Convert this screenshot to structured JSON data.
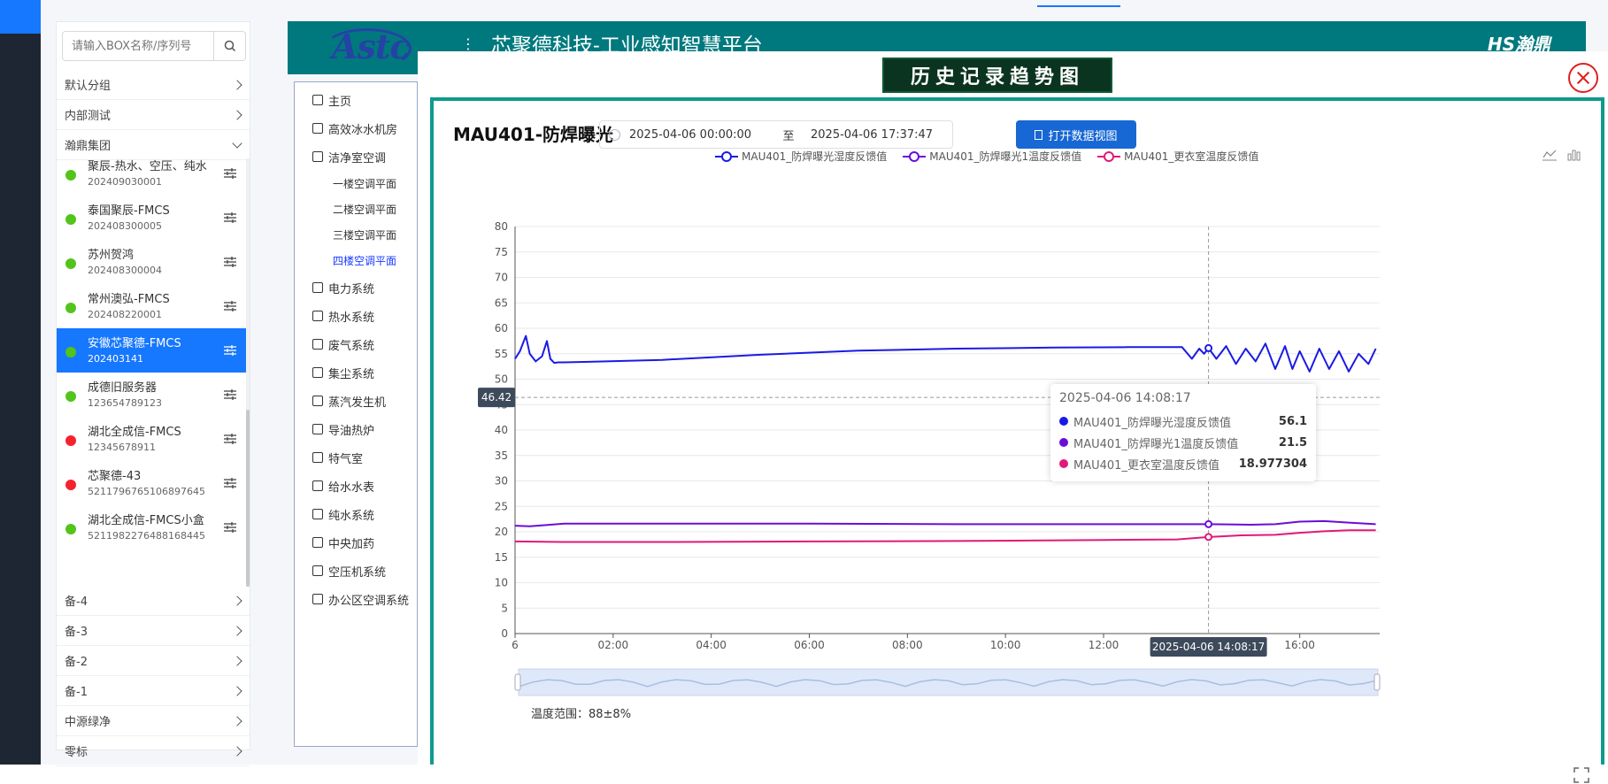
{
  "colors": {
    "accent": "#1677ff",
    "header": "#00797e",
    "frame": "#0f9a8e",
    "online": "#52c41a",
    "offline": "#f5222d"
  },
  "sidebar": {
    "search_placeholder": "请输入BOX名称/序列号",
    "groups_top": [
      "默认分组",
      "内部测试",
      "瀚鼎集团"
    ],
    "devices": [
      {
        "name": "聚辰-热水、空压、纯水",
        "sn": "202409030001",
        "status": "online",
        "active": false
      },
      {
        "name": "泰国聚辰-FMCS",
        "sn": "202408300005",
        "status": "online",
        "active": false
      },
      {
        "name": "苏州贺鸿",
        "sn": "202408300004",
        "status": "online",
        "active": false
      },
      {
        "name": "常州澳弘-FMCS",
        "sn": "202408220001",
        "status": "online",
        "active": false
      },
      {
        "name": "安徽芯聚德-FMCS",
        "sn": "202403141",
        "status": "online",
        "active": true
      },
      {
        "name": "成德旧服务器",
        "sn": "123654789123",
        "status": "online",
        "active": false
      },
      {
        "name": "湖北全成信-FMCS",
        "sn": "12345678911",
        "status": "offline",
        "active": false
      },
      {
        "name": "芯聚德-43",
        "sn": "5211796765106897645",
        "status": "offline",
        "active": false
      },
      {
        "name": "湖北全成信-FMCS小盒",
        "sn": "5211982276488168445",
        "status": "online",
        "active": false
      }
    ],
    "groups_bottom": [
      "备-4",
      "备-3",
      "备-2",
      "备-1",
      "中源绿净",
      "零标"
    ]
  },
  "header": {
    "logo": "Astc",
    "title": "芯聚德科技-工业感知智慧平台",
    "brand": "HS瀚鼎"
  },
  "nav": {
    "items": [
      "主页",
      "高效冰水机房",
      "洁净室空调"
    ],
    "subs": [
      "一楼空调平面",
      "二楼空调平面",
      "三楼空调平面",
      "四楼空调平面"
    ],
    "items2": [
      "电力系统",
      "热水系统",
      "废气系统",
      "集尘系统",
      "蒸汽发生机",
      "导油热炉",
      "特气室",
      "给水水表",
      "纯水系统",
      "中央加药",
      "空压机系统",
      "办公区空调系统"
    ]
  },
  "modal": {
    "title": "历史记录趋势图",
    "chart_name": "MAU401-防焊曝光",
    "date_start": "2025-04-06 00:00:00",
    "date_sep": "至",
    "date_end": "2025-04-06 17:37:47",
    "open_view": "打开数据视图",
    "temp_note": "温度范围：88±8%",
    "cursor_y_label": "46.42",
    "cursor_x_label": "2025-04-06 14:08:17"
  },
  "tooltip": {
    "time": "2025-04-06 14:08:17",
    "rows": [
      {
        "name": "MAU401_防焊曝光湿度反馈值",
        "value": "56.1",
        "color": "#1a1ae6"
      },
      {
        "name": "MAU401_防焊曝光1温度反馈值",
        "value": "21.5",
        "color": "#6a0dd9"
      },
      {
        "name": "MAU401_更衣室温度反馈值",
        "value": "18.977304",
        "color": "#e0197a"
      }
    ]
  },
  "chart_data": {
    "type": "line",
    "x_unit": "hour",
    "xlim": [
      0,
      17.63
    ],
    "x_ticks": [
      "6",
      "02:00",
      "04:00",
      "06:00",
      "08:00",
      "10:00",
      "12:00",
      "16:00"
    ],
    "x_tick_hours": [
      0,
      2,
      4,
      6,
      8,
      10,
      12,
      16
    ],
    "ylim": [
      0,
      80
    ],
    "y_ticks": [
      0,
      5,
      10,
      15,
      20,
      25,
      30,
      35,
      40,
      45,
      50,
      55,
      60,
      65,
      70,
      75,
      80
    ],
    "grid": true,
    "legend": "top",
    "series": [
      {
        "name": "MAU401_防焊曝光湿度反馈值",
        "color": "#1a1ae6",
        "x": [
          0,
          0.1,
          0.22,
          0.3,
          0.42,
          0.55,
          0.65,
          0.72,
          0.8,
          0.88,
          1.0,
          1.5,
          3,
          5,
          7,
          9,
          11,
          12.5,
          13.6,
          13.8,
          13.95,
          14.05,
          14.14,
          14.3,
          14.5,
          14.7,
          14.9,
          15.1,
          15.3,
          15.5,
          15.7,
          15.85,
          16.0,
          16.2,
          16.4,
          16.6,
          16.8,
          17.0,
          17.2,
          17.4,
          17.55
        ],
        "y": [
          54,
          55.5,
          58.5,
          55,
          53.5,
          54.5,
          57.5,
          54,
          53.2,
          53.3,
          53.3,
          53.4,
          53.8,
          54.8,
          55.6,
          56,
          56.2,
          56.3,
          56.3,
          54,
          56,
          55,
          56.1,
          54,
          56.5,
          53,
          56,
          53.5,
          57,
          52,
          56.5,
          52,
          55.5,
          51.5,
          56,
          52,
          55.5,
          51.5,
          55,
          53,
          56
        ]
      },
      {
        "name": "MAU401_防焊曝光1温度反馈值",
        "color": "#6a0dd9",
        "x": [
          0,
          0.3,
          0.6,
          1,
          3,
          6,
          9,
          12,
          14.14,
          15,
          15.5,
          16,
          16.5,
          17,
          17.55
        ],
        "y": [
          21.2,
          21.1,
          21.3,
          21.6,
          21.6,
          21.6,
          21.5,
          21.5,
          21.5,
          21.4,
          21.5,
          22,
          22.1,
          21.8,
          21.5
        ]
      },
      {
        "name": "MAU401_更衣室温度反馈值",
        "color": "#e0197a",
        "x": [
          0,
          1,
          3,
          6,
          9,
          12,
          13.5,
          14.14,
          14.8,
          15.5,
          16,
          16.5,
          17,
          17.55
        ],
        "y": [
          18.1,
          18.0,
          18.0,
          18.1,
          18.2,
          18.4,
          18.5,
          18.98,
          19.3,
          19.4,
          19.8,
          20.1,
          20.3,
          20.3
        ]
      }
    ],
    "cursor": {
      "x": 14.14,
      "y": 46.42
    }
  },
  "icons": {
    "search": "search-icon",
    "close": "close-icon",
    "config": "sliders-icon",
    "clock": "clock-icon",
    "doc": "document-icon",
    "line_tool": "line-chart-icon",
    "bar_tool": "bar-chart-icon",
    "fullscreen": "fullscreen-icon"
  }
}
